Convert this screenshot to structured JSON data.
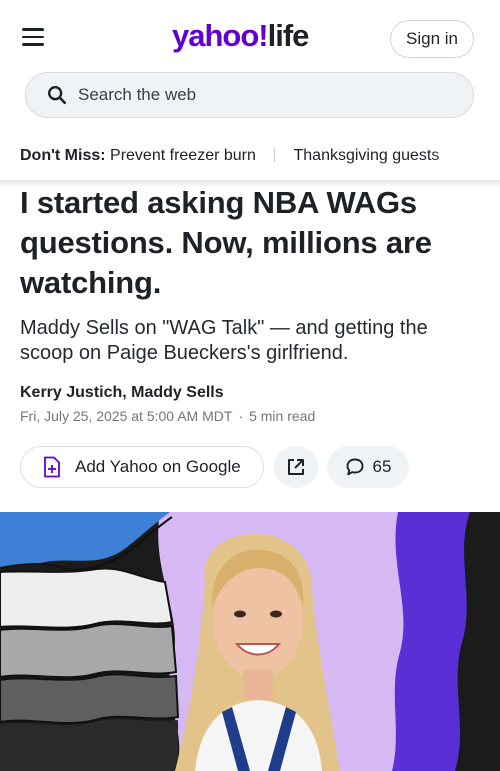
{
  "header": {
    "logo_brand": "yahoo!",
    "logo_section": "life",
    "signin_label": "Sign in",
    "menu_icon": "hamburger-menu-icon"
  },
  "search": {
    "placeholder": "Search the web",
    "icon": "search-icon"
  },
  "dont_miss": {
    "lead": "Don't Miss:",
    "items": [
      "Prevent freezer burn",
      "Thanksgiving guests"
    ]
  },
  "article": {
    "headline": "I started asking NBA WAGs questions. Now, millions are watching.",
    "subheadline": "Maddy Sells on \"WAG Talk\" — and getting the scoop on Paige Bueckers's girlfriend.",
    "authors": "Kerry Justich, Maddy Sells",
    "date": "Fri, July 25, 2025 at 5:00 AM MDT",
    "read_time": "5 min read",
    "meta_separator": "·"
  },
  "actions": {
    "add_google_label": "Add Yahoo on Google",
    "add_google_icon": "add-document-icon",
    "share_icon": "share-external-icon",
    "comments_icon": "comment-bubble-icon",
    "comments_count": "65"
  },
  "colors": {
    "brand": "#6001d2",
    "text": "#1d2228",
    "muted": "#6e7780",
    "pill_bg": "#f0f3f5",
    "hero_purple": "#d6b8f2",
    "hero_violet": "#5a2fd6",
    "hero_blue": "#3d7fd4"
  }
}
